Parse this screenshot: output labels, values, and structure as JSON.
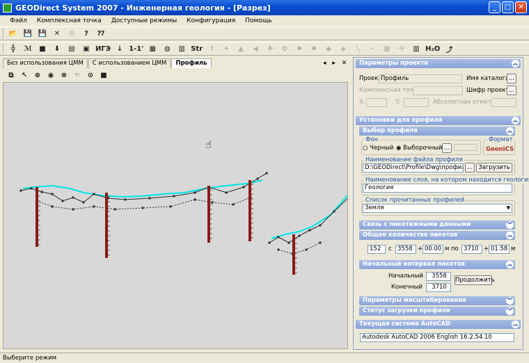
{
  "window": {
    "title": "GEODirect System 2007 - Инженерная геология - [Разрез]",
    "minimize": "_",
    "maximize": "□",
    "close": "✕"
  },
  "menu": [
    "Файл",
    "Комплексная точка",
    "Доступные режимы",
    "Конфигурация",
    "Помощь"
  ],
  "toolbar1": [
    {
      "name": "open-folder-icon",
      "glyph": "📂",
      "dis": false
    },
    {
      "name": "save-icon",
      "glyph": "💾",
      "dis": false
    },
    {
      "name": "save-disabled-icon",
      "glyph": "💾",
      "dis": true
    },
    {
      "name": "delete-icon",
      "glyph": "✕",
      "dis": false
    },
    {
      "name": "settings-icon",
      "glyph": "⚙",
      "dis": true
    },
    {
      "name": "help-icon",
      "glyph": "?",
      "dis": false
    },
    {
      "name": "context-help-icon",
      "glyph": "⁇",
      "dis": false
    }
  ],
  "toolbar2": [
    {
      "name": "pile-icon",
      "glyph": "╬",
      "dis": false
    },
    {
      "name": "fence-icon",
      "glyph": "ℳ",
      "dis": false
    },
    {
      "name": "square-icon",
      "glyph": "■",
      "dis": false
    },
    {
      "name": "download-icon",
      "glyph": "⬇",
      "dis": false
    },
    {
      "name": "list-icon",
      "glyph": "▤",
      "dis": false
    },
    {
      "name": "chart-icon",
      "glyph": "▣",
      "dis": false
    },
    {
      "name": "ige-icon",
      "glyph": "ИГЭ",
      "dis": false
    },
    {
      "name": "arrow-down-icon",
      "glyph": "↓",
      "dis": false
    },
    {
      "name": "ratio-icon",
      "glyph": "1-1'",
      "dis": false
    },
    {
      "name": "grid-icon",
      "glyph": "▦",
      "dis": false
    },
    {
      "name": "globe-icon",
      "glyph": "◍",
      "dis": false
    },
    {
      "name": "book-icon",
      "glyph": "▥",
      "dis": false
    },
    {
      "name": "str-icon",
      "glyph": "Str",
      "dis": false
    },
    {
      "name": "up-icon",
      "glyph": "↑",
      "dis": true
    },
    {
      "name": "tool-a-icon",
      "glyph": "✦",
      "dis": true
    },
    {
      "name": "tool-b-icon",
      "glyph": "▲",
      "dis": true
    },
    {
      "name": "tool-c-icon",
      "glyph": "◀",
      "dis": true
    },
    {
      "name": "tool-d-icon",
      "glyph": "✚",
      "dis": true
    },
    {
      "name": "tool-e-icon",
      "glyph": "✿",
      "dis": true
    },
    {
      "name": "tool-f-icon",
      "glyph": "✸",
      "dis": true
    },
    {
      "name": "tool-g-icon",
      "glyph": "✹",
      "dis": true
    },
    {
      "name": "tool-h-icon",
      "glyph": "◆",
      "dis": true
    },
    {
      "name": "tool-i-icon",
      "glyph": "◈",
      "dis": true
    },
    {
      "name": "tool-j-icon",
      "glyph": "╲",
      "dis": true
    },
    {
      "name": "tool-k-icon",
      "glyph": "⌁",
      "dis": true
    },
    {
      "name": "tool-l-icon",
      "glyph": "▦",
      "dis": true
    },
    {
      "name": "tool-m-icon",
      "glyph": "✣",
      "dis": true
    },
    {
      "name": "ruler-icon",
      "glyph": "▥",
      "dis": false
    },
    {
      "name": "h2o-icon",
      "glyph": "H₂O",
      "dis": false
    },
    {
      "name": "curve-icon",
      "glyph": "⤴",
      "dis": false
    }
  ],
  "tabs": [
    {
      "label": "Без использования ЦММ",
      "active": false
    },
    {
      "label": "С использованием ЦММ",
      "active": false
    },
    {
      "label": "Профиль",
      "active": true
    }
  ],
  "tabnav": "◂ ▸ ✕",
  "subtools": [
    {
      "name": "select-icon",
      "glyph": "⧉"
    },
    {
      "name": "pointer-icon",
      "glyph": "↖"
    },
    {
      "name": "crosshair-icon",
      "glyph": "⊕"
    },
    {
      "name": "target-icon",
      "glyph": "◉"
    },
    {
      "name": "delete-point-icon",
      "glyph": "⊗"
    },
    {
      "name": "hand-icon",
      "glyph": "☜"
    },
    {
      "name": "circle-icon",
      "glyph": "⊙"
    },
    {
      "name": "save-small-icon",
      "glyph": "■"
    }
  ],
  "panel": {
    "project_params": "Параметры проекта",
    "project_label": "Проект:",
    "project_value": "Профиль",
    "catalog_label": "Имя каталога",
    "complex_label": "Комплексная точка:",
    "cipher_label": "Шифр проекта",
    "x_label": "X:",
    "y_label": "Y:",
    "abs_label": "Абсолютная отметка:",
    "profile_settings": "Установки для профиля",
    "profile_choice": "Выбор профиля",
    "background": "Фон",
    "black": "Черный",
    "selected": "Выборочный",
    "format": "Формат",
    "format_value": "GeoniCS",
    "file_name_label": "Наименование файла профиля",
    "file_name_value": "D:\\GEODirect\\Profile\\Dwg\\профиль_n",
    "load_button": "Загрузить",
    "layer_label": "Наименование слоя, на котором находится геология",
    "layer_value": "Геология",
    "read_list_label": "Список прочитанных профилей",
    "read_list_value": "Земля",
    "picket_link": "Связь с пикетажными данными",
    "total_pickets": "Общее количество пикетов",
    "count": "152",
    "c": "с",
    "from_main": "3558",
    "plus": "+",
    "from_add": "00.00",
    "m": "м",
    "to": "по",
    "to_main": "3710",
    "to_add": "01.58",
    "m2": "м",
    "start_interval": "Начальный интервал пикетов",
    "start_label": "Начальный",
    "start_value": "3558",
    "end_label": "Конечный",
    "end_value": "3710",
    "continue_button": "Продолжить",
    "scale_params": "Параметры масштабирования",
    "load_status": "Статус загрузки профиля",
    "autocad_current": "Текущая система AutoCAD",
    "autocad_value": "Autodesk AutoCAD 2006 English 16.2.54.10",
    "more": "...",
    "chev_up": "︽",
    "chev_down": "︾"
  },
  "status": "Выберите режим",
  "colors": {
    "ground": "#2a2a2a",
    "water": "#00e5e5",
    "pile": "#8b1a1a"
  }
}
